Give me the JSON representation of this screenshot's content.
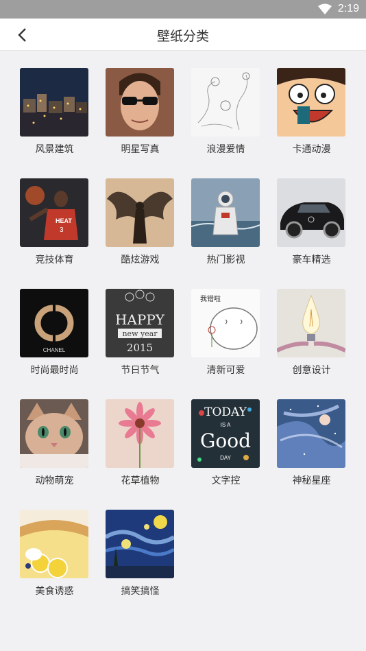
{
  "status_bar": {
    "time": "2:19",
    "icons": [
      "wifi-icon"
    ]
  },
  "header": {
    "title": "壁纸分类",
    "back_icon": "back-arrow-icon"
  },
  "categories": [
    {
      "label": "风景建筑",
      "thumb": "night-town"
    },
    {
      "label": "明星写真",
      "thumb": "man-sunglasses"
    },
    {
      "label": "浪漫爱情",
      "thumb": "sketch-flowers"
    },
    {
      "label": "卡通动漫",
      "thumb": "cartoon-face"
    },
    {
      "label": "竞技体育",
      "thumb": "basketball-player"
    },
    {
      "label": "酷炫游戏",
      "thumb": "winged-warrior"
    },
    {
      "label": "热门影视",
      "thumb": "astronaut"
    },
    {
      "label": "豪车精选",
      "thumb": "sports-car"
    },
    {
      "label": "时尚最时尚",
      "thumb": "chanel-logo",
      "thumb_text": "CHANEL"
    },
    {
      "label": "节日节气",
      "thumb": "happy-new-year",
      "thumb_text": [
        "HAPPY",
        "new year",
        "2015"
      ]
    },
    {
      "label": "清新可爱",
      "thumb": "cute-doodle",
      "thumb_text": "我错啦"
    },
    {
      "label": "创意设计",
      "thumb": "light-bulb"
    },
    {
      "label": "动物萌宠",
      "thumb": "kitten"
    },
    {
      "label": "花草植物",
      "thumb": "pink-daisy"
    },
    {
      "label": "文字控",
      "thumb": "today-is-good-day",
      "thumb_text": [
        "TODAY",
        "IS A",
        "Good",
        "DAY"
      ]
    },
    {
      "label": "神秘星座",
      "thumb": "zodiac-girl"
    },
    {
      "label": "美食诱惑",
      "thumb": "lemon-tart"
    },
    {
      "label": "搞笑搞怪",
      "thumb": "starry-night"
    }
  ],
  "colors": {
    "status_bar": "#9e9e9e",
    "app_bar": "#ffffff",
    "background": "#f1f1f3",
    "text": "#333333"
  }
}
